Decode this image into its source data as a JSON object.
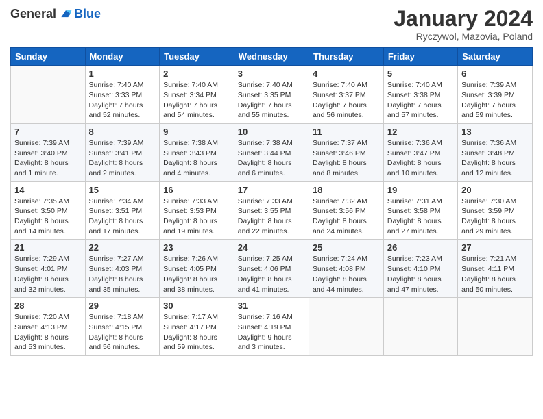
{
  "logo": {
    "text_general": "General",
    "text_blue": "Blue"
  },
  "title": "January 2024",
  "subtitle": "Ryczywol, Mazovia, Poland",
  "days_of_week": [
    "Sunday",
    "Monday",
    "Tuesday",
    "Wednesday",
    "Thursday",
    "Friday",
    "Saturday"
  ],
  "weeks": [
    [
      {
        "day": "",
        "info": ""
      },
      {
        "day": "1",
        "info": "Sunrise: 7:40 AM\nSunset: 3:33 PM\nDaylight: 7 hours\nand 52 minutes."
      },
      {
        "day": "2",
        "info": "Sunrise: 7:40 AM\nSunset: 3:34 PM\nDaylight: 7 hours\nand 54 minutes."
      },
      {
        "day": "3",
        "info": "Sunrise: 7:40 AM\nSunset: 3:35 PM\nDaylight: 7 hours\nand 55 minutes."
      },
      {
        "day": "4",
        "info": "Sunrise: 7:40 AM\nSunset: 3:37 PM\nDaylight: 7 hours\nand 56 minutes."
      },
      {
        "day": "5",
        "info": "Sunrise: 7:40 AM\nSunset: 3:38 PM\nDaylight: 7 hours\nand 57 minutes."
      },
      {
        "day": "6",
        "info": "Sunrise: 7:39 AM\nSunset: 3:39 PM\nDaylight: 7 hours\nand 59 minutes."
      }
    ],
    [
      {
        "day": "7",
        "info": "Sunrise: 7:39 AM\nSunset: 3:40 PM\nDaylight: 8 hours\nand 1 minute."
      },
      {
        "day": "8",
        "info": "Sunrise: 7:39 AM\nSunset: 3:41 PM\nDaylight: 8 hours\nand 2 minutes."
      },
      {
        "day": "9",
        "info": "Sunrise: 7:38 AM\nSunset: 3:43 PM\nDaylight: 8 hours\nand 4 minutes."
      },
      {
        "day": "10",
        "info": "Sunrise: 7:38 AM\nSunset: 3:44 PM\nDaylight: 8 hours\nand 6 minutes."
      },
      {
        "day": "11",
        "info": "Sunrise: 7:37 AM\nSunset: 3:46 PM\nDaylight: 8 hours\nand 8 minutes."
      },
      {
        "day": "12",
        "info": "Sunrise: 7:36 AM\nSunset: 3:47 PM\nDaylight: 8 hours\nand 10 minutes."
      },
      {
        "day": "13",
        "info": "Sunrise: 7:36 AM\nSunset: 3:48 PM\nDaylight: 8 hours\nand 12 minutes."
      }
    ],
    [
      {
        "day": "14",
        "info": "Sunrise: 7:35 AM\nSunset: 3:50 PM\nDaylight: 8 hours\nand 14 minutes."
      },
      {
        "day": "15",
        "info": "Sunrise: 7:34 AM\nSunset: 3:51 PM\nDaylight: 8 hours\nand 17 minutes."
      },
      {
        "day": "16",
        "info": "Sunrise: 7:33 AM\nSunset: 3:53 PM\nDaylight: 8 hours\nand 19 minutes."
      },
      {
        "day": "17",
        "info": "Sunrise: 7:33 AM\nSunset: 3:55 PM\nDaylight: 8 hours\nand 22 minutes."
      },
      {
        "day": "18",
        "info": "Sunrise: 7:32 AM\nSunset: 3:56 PM\nDaylight: 8 hours\nand 24 minutes."
      },
      {
        "day": "19",
        "info": "Sunrise: 7:31 AM\nSunset: 3:58 PM\nDaylight: 8 hours\nand 27 minutes."
      },
      {
        "day": "20",
        "info": "Sunrise: 7:30 AM\nSunset: 3:59 PM\nDaylight: 8 hours\nand 29 minutes."
      }
    ],
    [
      {
        "day": "21",
        "info": "Sunrise: 7:29 AM\nSunset: 4:01 PM\nDaylight: 8 hours\nand 32 minutes."
      },
      {
        "day": "22",
        "info": "Sunrise: 7:27 AM\nSunset: 4:03 PM\nDaylight: 8 hours\nand 35 minutes."
      },
      {
        "day": "23",
        "info": "Sunrise: 7:26 AM\nSunset: 4:05 PM\nDaylight: 8 hours\nand 38 minutes."
      },
      {
        "day": "24",
        "info": "Sunrise: 7:25 AM\nSunset: 4:06 PM\nDaylight: 8 hours\nand 41 minutes."
      },
      {
        "day": "25",
        "info": "Sunrise: 7:24 AM\nSunset: 4:08 PM\nDaylight: 8 hours\nand 44 minutes."
      },
      {
        "day": "26",
        "info": "Sunrise: 7:23 AM\nSunset: 4:10 PM\nDaylight: 8 hours\nand 47 minutes."
      },
      {
        "day": "27",
        "info": "Sunrise: 7:21 AM\nSunset: 4:11 PM\nDaylight: 8 hours\nand 50 minutes."
      }
    ],
    [
      {
        "day": "28",
        "info": "Sunrise: 7:20 AM\nSunset: 4:13 PM\nDaylight: 8 hours\nand 53 minutes."
      },
      {
        "day": "29",
        "info": "Sunrise: 7:18 AM\nSunset: 4:15 PM\nDaylight: 8 hours\nand 56 minutes."
      },
      {
        "day": "30",
        "info": "Sunrise: 7:17 AM\nSunset: 4:17 PM\nDaylight: 8 hours\nand 59 minutes."
      },
      {
        "day": "31",
        "info": "Sunrise: 7:16 AM\nSunset: 4:19 PM\nDaylight: 9 hours\nand 3 minutes."
      },
      {
        "day": "",
        "info": ""
      },
      {
        "day": "",
        "info": ""
      },
      {
        "day": "",
        "info": ""
      }
    ]
  ]
}
